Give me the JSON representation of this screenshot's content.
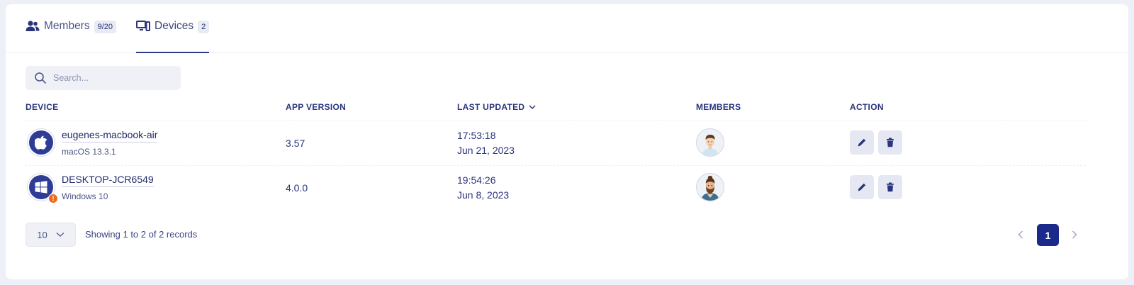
{
  "tabs": [
    {
      "label": "Members",
      "count": "9/20",
      "icon": "users-icon",
      "active": false
    },
    {
      "label": "Devices",
      "count": "2",
      "icon": "devices-icon",
      "active": true
    }
  ],
  "search": {
    "placeholder": "Search..."
  },
  "table": {
    "headers": {
      "device": "DEVICE",
      "app_version": "APP VERSION",
      "last_updated": "LAST UPDATED",
      "members": "MEMBERS",
      "action": "ACTION"
    },
    "rows": [
      {
        "device_name": "eugenes-macbook-air",
        "os": "macOS 13.3.1",
        "os_icon": "apple-icon",
        "warning": false,
        "app_version": "3.57",
        "time": "17:53:18",
        "date": "Jun 21, 2023",
        "member_avatar": "member-avatar-man"
      },
      {
        "device_name": "DESKTOP-JCR6549",
        "os": "Windows 10",
        "os_icon": "windows-icon",
        "warning": true,
        "warning_symbol": "!",
        "app_version": "4.0.0",
        "time": "19:54:26",
        "date": "Jun 8, 2023",
        "member_avatar": "member-avatar-bearded-man"
      }
    ]
  },
  "footer": {
    "page_size": "10",
    "records_text": "Showing 1 to 2 of 2 records",
    "current_page": "1"
  },
  "colors": {
    "accent": "#1b2a8a",
    "text": "#1f2a6b",
    "warning": "#f06a1d",
    "background": "#eef0f7"
  }
}
